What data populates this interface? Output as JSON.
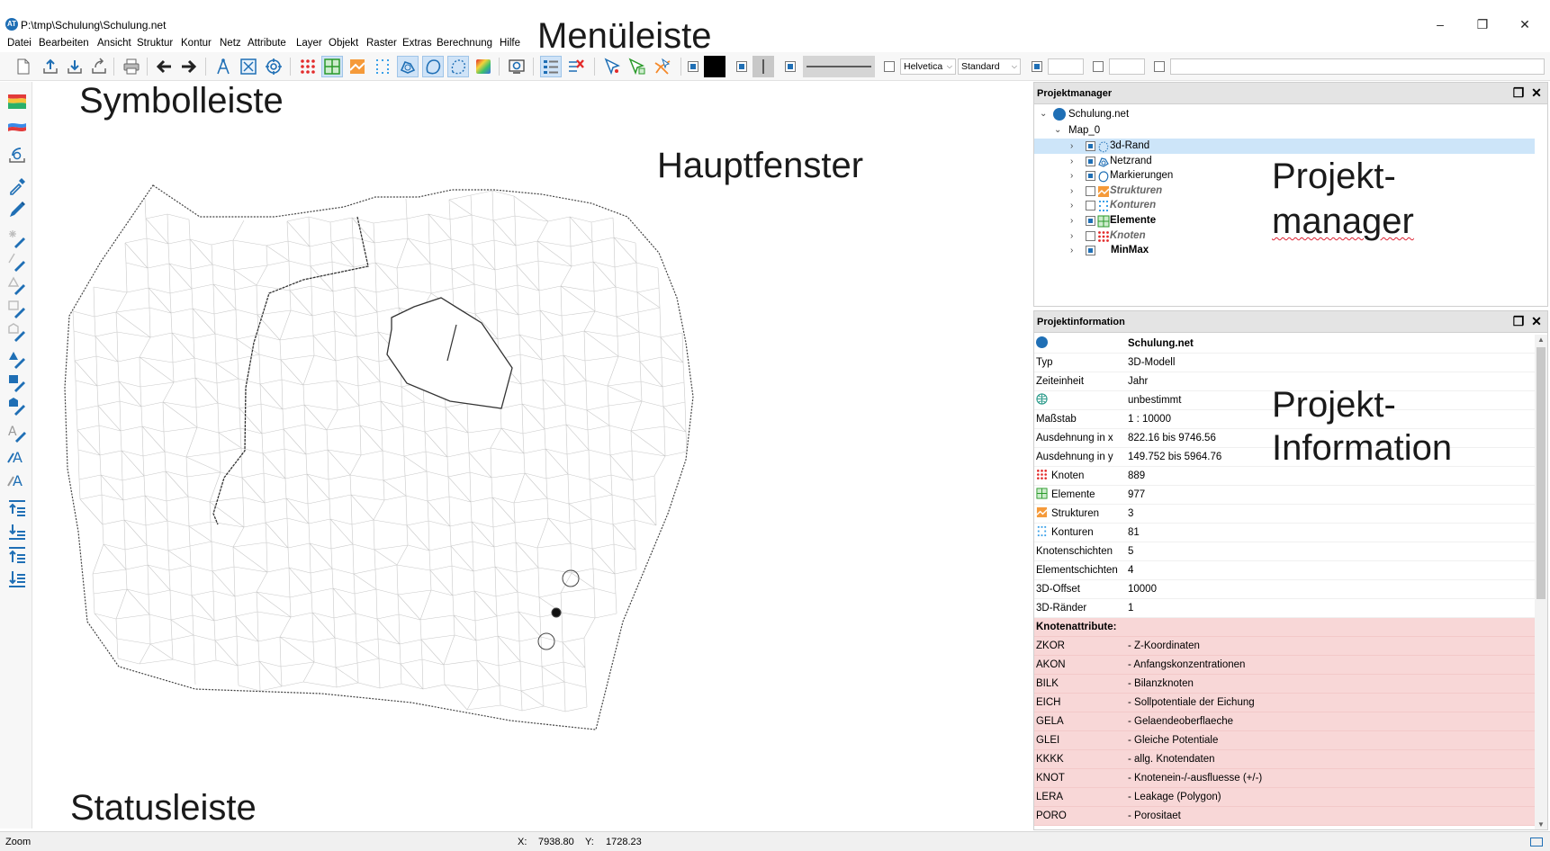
{
  "window": {
    "title": "P:\\tmp\\Schulung\\Schulung.net",
    "minimize": "–",
    "restore": "❐",
    "close": "✕"
  },
  "menu": [
    "Datei",
    "Bearbeiten",
    "Ansicht",
    "Struktur",
    "Kontur",
    "Netz",
    "Attribute",
    "Layer",
    "Objekt",
    "Raster",
    "Extras",
    "Berechnung",
    "Hilfe"
  ],
  "toolbar": {
    "font_family": "Helvetica",
    "font_style": "Standard"
  },
  "annotations": {
    "menu_bar": "Menüleiste",
    "symbol_bar": "Symbolleiste",
    "main_window": "Hauptfenster",
    "status_bar": "Statusleiste",
    "project_manager_1": "Projekt-",
    "project_manager_2": "manager",
    "project_info_1": "Projekt-",
    "project_info_2": "Information"
  },
  "project_manager": {
    "title": "Projektmanager",
    "root": "Schulung.net",
    "map": "Map_0",
    "layers": [
      {
        "label": "3d-Rand",
        "checked": true,
        "style": "normal",
        "selected": true,
        "icon": "rand-icon"
      },
      {
        "label": "Netzrand",
        "checked": true,
        "style": "normal",
        "selected": false,
        "icon": "netzrand-icon"
      },
      {
        "label": "Markierungen",
        "checked": true,
        "style": "normal",
        "selected": false,
        "icon": "markierungen-icon"
      },
      {
        "label": "Strukturen",
        "checked": false,
        "style": "italic",
        "selected": false,
        "icon": "strukturen-icon"
      },
      {
        "label": "Konturen",
        "checked": false,
        "style": "italic",
        "selected": false,
        "icon": "konturen-icon"
      },
      {
        "label": "Elemente",
        "checked": true,
        "style": "bold",
        "selected": false,
        "icon": "elemente-icon"
      },
      {
        "label": "Knoten",
        "checked": false,
        "style": "italic",
        "selected": false,
        "icon": "knoten-icon"
      },
      {
        "label": "MinMax",
        "checked": true,
        "style": "bold",
        "selected": false,
        "icon": ""
      }
    ]
  },
  "project_info": {
    "title": "Projektinformation",
    "name": "Schulung.net",
    "rows": [
      {
        "key": "Typ",
        "value": "3D-Modell"
      },
      {
        "key": "Zeiteinheit",
        "value": "Jahr"
      },
      {
        "key": "",
        "value": "unbestimmt",
        "icon": "globe-icon"
      },
      {
        "key": "Maßstab",
        "value": "1 : 10000"
      },
      {
        "key": "Ausdehnung in x",
        "value": "822.16 bis 9746.56"
      },
      {
        "key": "Ausdehnung in y",
        "value": "149.752 bis 5964.76"
      },
      {
        "key": "Knoten",
        "value": "889",
        "icon": "knoten-icon"
      },
      {
        "key": "Elemente",
        "value": "977",
        "icon": "elemente-icon"
      },
      {
        "key": "Strukturen",
        "value": "3",
        "icon": "strukturen-icon"
      },
      {
        "key": "Konturen",
        "value": "81",
        "icon": "konturen-icon"
      },
      {
        "key": "Knotenschichten",
        "value": "5"
      },
      {
        "key": "Elementschichten",
        "value": "4"
      },
      {
        "key": "3D-Offset",
        "value": "10000"
      },
      {
        "key": "3D-Ränder",
        "value": "1"
      }
    ],
    "attr_header": "Knotenattribute:",
    "attributes": [
      {
        "key": "ZKOR",
        "value": "- Z-Koordinaten"
      },
      {
        "key": "AKON",
        "value": "- Anfangskonzentrationen"
      },
      {
        "key": "BILK",
        "value": "- Bilanzknoten"
      },
      {
        "key": "EICH",
        "value": "- Sollpotentiale der Eichung"
      },
      {
        "key": "GELA",
        "value": "- Gelaendeoberflaeche"
      },
      {
        "key": "GLEI",
        "value": "- Gleiche Potentiale"
      },
      {
        "key": "KKKK",
        "value": "- allg. Knotendaten"
      },
      {
        "key": "KNOT",
        "value": "- Knotenein-/-ausfluesse (+/-)"
      },
      {
        "key": "LERA",
        "value": "- Leakage (Polygon)"
      },
      {
        "key": "PORO",
        "value": "- Porositaet"
      }
    ]
  },
  "status": {
    "mode": "Zoom",
    "x_label": "X:",
    "x_value": "7938.80",
    "y_label": "Y:",
    "y_value": "1728.23"
  },
  "colors": {
    "accent": "#1f6fb5",
    "selection": "#cde5f9",
    "attribute_highlight": "#f8d7d7",
    "toolbar_bg": "#f7f7f7"
  }
}
